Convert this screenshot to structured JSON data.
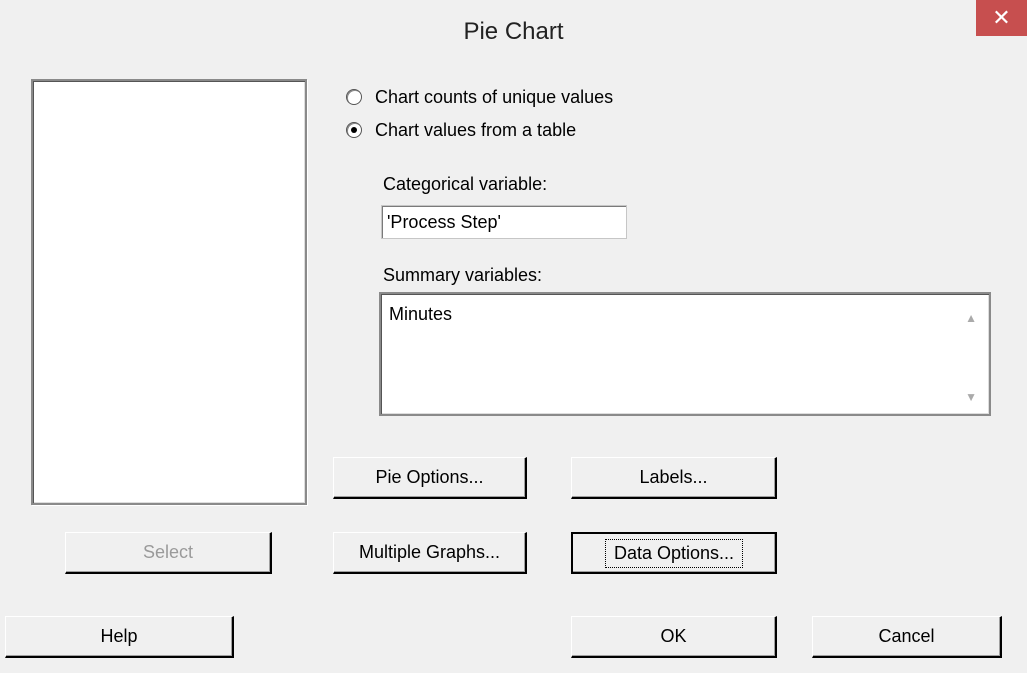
{
  "window": {
    "title": "Pie Chart",
    "close_glyph": "✕"
  },
  "source_list": {
    "items": []
  },
  "radios": [
    {
      "label": "Chart counts of unique values",
      "checked": false
    },
    {
      "label": "Chart values from a table",
      "checked": true
    }
  ],
  "categorical": {
    "label": "Categorical variable:",
    "value": "'Process Step'"
  },
  "summary": {
    "label": "Summary variables:",
    "value": "Minutes"
  },
  "buttons": {
    "pie_options": "Pie Options...",
    "labels": "Labels...",
    "select": "Select",
    "multiple_graphs": "Multiple Graphs...",
    "data_options": "Data Options...",
    "help": "Help",
    "ok": "OK",
    "cancel": "Cancel"
  },
  "colors": {
    "close_bg": "#c74f4f",
    "dialog_bg": "#f0f0f0"
  },
  "icons": {
    "close": "close-icon",
    "scroll_up": "chevron-up-icon",
    "scroll_down": "chevron-down-icon"
  }
}
